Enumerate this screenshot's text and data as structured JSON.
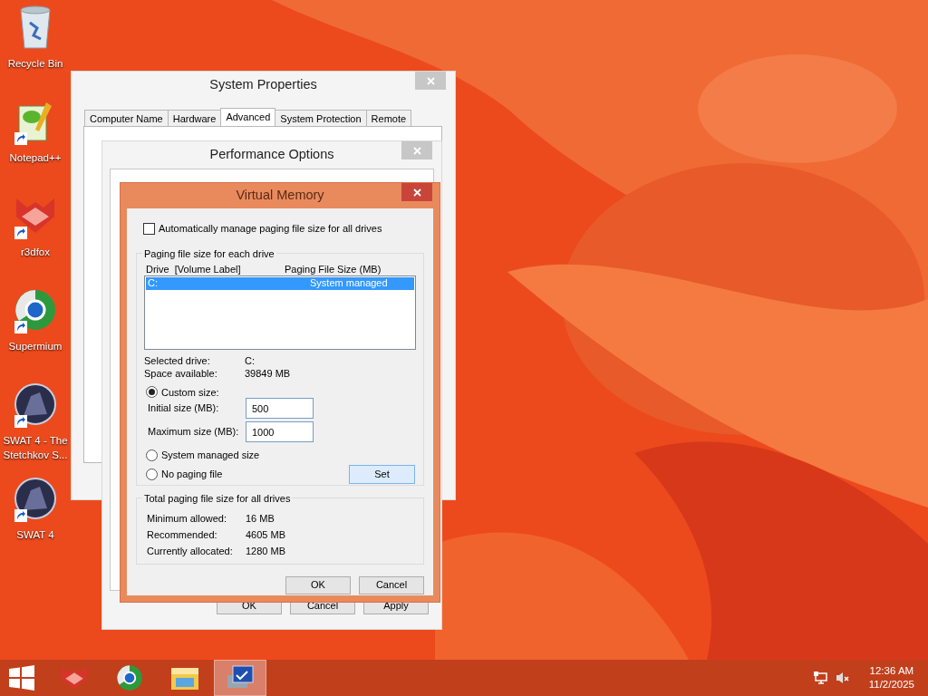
{
  "desktop_icons": [
    {
      "label": "Recycle Bin",
      "shortcut": false
    },
    {
      "label": "Notepad++",
      "shortcut": true
    },
    {
      "label": "r3dfox",
      "shortcut": true
    },
    {
      "label": "Supermium",
      "shortcut": true
    },
    {
      "label": "SWAT 4 - The Stetchkov S...",
      "shortcut": true
    },
    {
      "label": "SWAT 4",
      "shortcut": true
    }
  ],
  "system_properties": {
    "title": "System Properties",
    "tabs": [
      {
        "label": "Computer Name",
        "selected": false
      },
      {
        "label": "Hardware",
        "selected": false
      },
      {
        "label": "Advanced",
        "selected": true
      },
      {
        "label": "System Protection",
        "selected": false
      },
      {
        "label": "Remote",
        "selected": false
      }
    ]
  },
  "performance_options": {
    "title": "Performance Options",
    "buttons": [
      "OK",
      "Cancel",
      "Apply"
    ]
  },
  "virtual_memory": {
    "title": "Virtual Memory",
    "auto_manage": {
      "label": "Automatically manage paging file size for all drives",
      "checked": false
    },
    "drive_group": {
      "title": "Paging file size for each drive",
      "columns": [
        "Drive  [Volume Label]",
        "Paging File Size (MB)"
      ],
      "drives": [
        {
          "drive": "C:",
          "size": "System managed",
          "selected": true
        }
      ],
      "info": [
        {
          "label": "Selected drive:",
          "value": "C:"
        },
        {
          "label": "Space available:",
          "value": "39849 MB"
        }
      ],
      "options": [
        {
          "label": "Custom size:",
          "selected": true
        },
        {
          "label": "System managed size",
          "selected": false
        },
        {
          "label": "No paging file",
          "selected": false
        }
      ],
      "fields": [
        {
          "label": "Initial size (MB):",
          "value": "500"
        },
        {
          "label": "Maximum size (MB):",
          "value": "1000"
        }
      ],
      "set_button": "Set"
    },
    "total_group": {
      "title": "Total paging file size for all drives",
      "rows": [
        {
          "label": "Minimum allowed:",
          "value": "16 MB"
        },
        {
          "label": "Recommended:",
          "value": "4605 MB"
        },
        {
          "label": "Currently allocated:",
          "value": "1280 MB"
        }
      ]
    },
    "buttons": [
      "OK",
      "Cancel"
    ]
  },
  "taskbar": {
    "apps": [
      {
        "active": false
      },
      {
        "active": false
      },
      {
        "active": false
      },
      {
        "active": true
      }
    ]
  },
  "clock": {
    "time": "12:36 AM",
    "date": "11/2/2025"
  }
}
